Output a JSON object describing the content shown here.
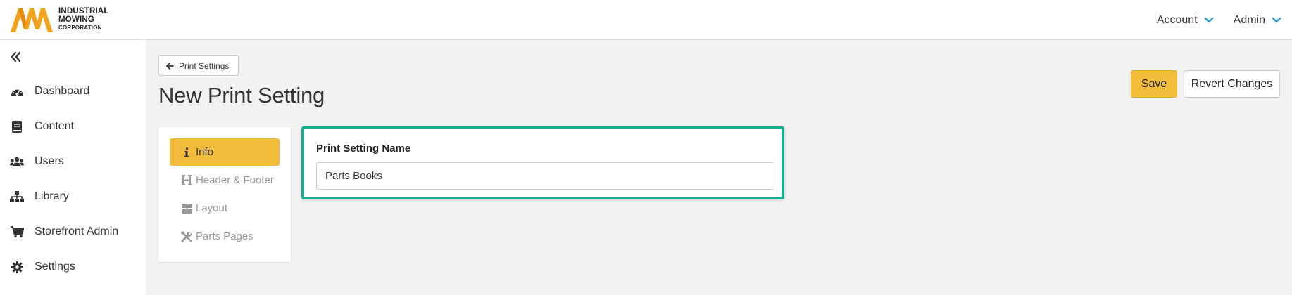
{
  "brand": {
    "line1": "INDUSTRIAL",
    "line2": "MOWING",
    "line3": "CORPORATION",
    "color": "#f3a21b"
  },
  "top_nav": {
    "account_label": "Account",
    "admin_label": "Admin"
  },
  "sidebar": {
    "items": [
      {
        "label": "Dashboard",
        "icon": "tachometer-icon"
      },
      {
        "label": "Content",
        "icon": "book-icon"
      },
      {
        "label": "Users",
        "icon": "users-icon"
      },
      {
        "label": "Library",
        "icon": "sitemap-icon"
      },
      {
        "label": "Storefront Admin",
        "icon": "cart-icon"
      },
      {
        "label": "Settings",
        "icon": "gear-icon"
      }
    ]
  },
  "main": {
    "back_label": "Print Settings",
    "title": "New Print Setting",
    "save_label": "Save",
    "revert_label": "Revert Changes"
  },
  "tabs": [
    {
      "label": "Info",
      "icon": "info-icon",
      "active": true
    },
    {
      "label": "Header & Footer",
      "icon": "header-icon",
      "active": false
    },
    {
      "label": "Layout",
      "icon": "layout-grid-icon",
      "active": false
    },
    {
      "label": "Parts Pages",
      "icon": "tools-icon",
      "active": false
    }
  ],
  "form": {
    "name_label": "Print Setting Name",
    "name_value": "Parts Books"
  },
  "colors": {
    "accent": "#f3bb3a",
    "highlight_border": "#17ae8f",
    "chevron": "#2a9fd6"
  }
}
